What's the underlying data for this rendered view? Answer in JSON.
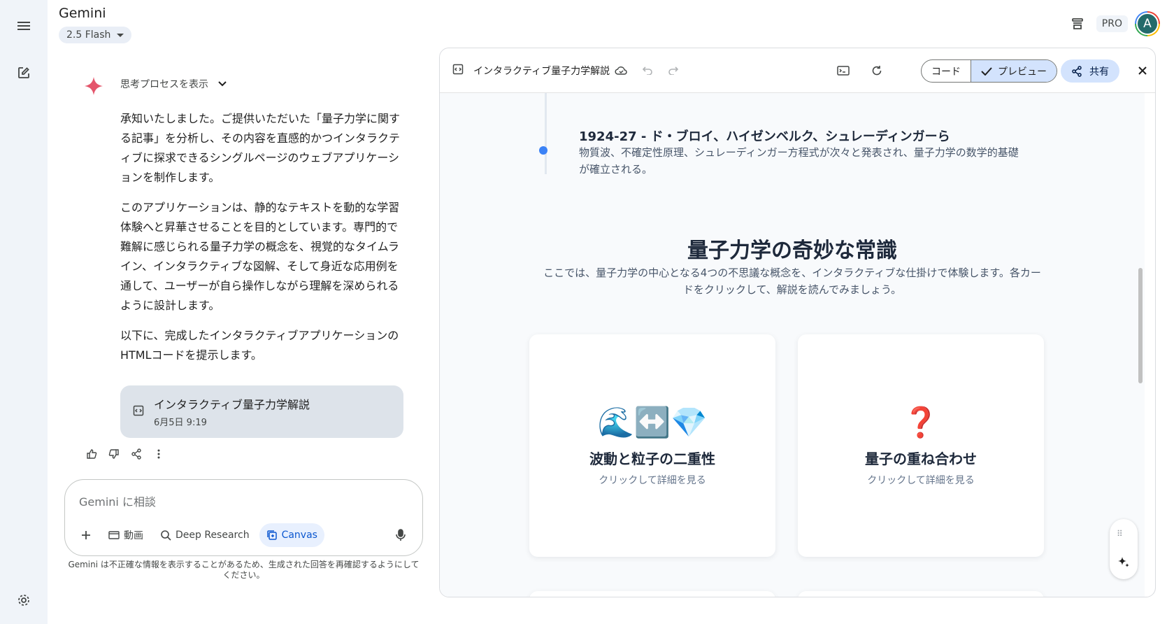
{
  "app": {
    "title": "Gemini",
    "model": "2.5 Flash",
    "pro_label": "PRO",
    "avatar_initial": "A"
  },
  "rail": {
    "menu_icon": "menu-icon",
    "new_chat_icon": "edit-icon",
    "settings_icon": "gear-icon"
  },
  "chat": {
    "thought_label": "思考プロセスを表示",
    "paragraphs": [
      "承知いたしました。ご提供いただいた「量子力学に関する記事」を分析し、その内容を直感的かつインタラクティブに探求できるシングルページのウェブアプリケーションを制作します。",
      "このアプリケーションは、静的なテキストを動的な学習体験へと昇華させることを目的としています。専門的で難解に感じられる量子力学の概念を、視覚的なタイムライン、インタラクティブな図解、そして身近な応用例を通して、ユーザーが自ら操作しながら理解を深められるように設計します。",
      "以下に、完成したインタラクティブアプリケーションのHTMLコードを提示します。"
    ],
    "artifact": {
      "title": "インタラクティブ量子力学解説",
      "date": "6月5日 9:19"
    }
  },
  "input": {
    "placeholder": "Gemini に相談",
    "tools": {
      "video": "動画",
      "deep_research": "Deep Research",
      "canvas": "Canvas"
    },
    "disclaimer": "Gemini は不正確な情報を表示することがあるため、生成された回答を再確認するようにしてください。"
  },
  "canvas": {
    "title": "インタラクティブ量子力学解説",
    "code_label": "コード",
    "preview_label": "プレビュー",
    "share_label": "共有",
    "timeline": {
      "title": "1924-27 - ド・ブロイ、ハイゼンベルク、シュレーディンガーら",
      "desc": "物質波、不確定性原理、シュレーディンガー方程式が次々と発表され、量子力学の数学的基礎が確立される。"
    },
    "section_title": "量子力学の奇妙な常識",
    "section_lead": "ここでは、量子力学の中心となる4つの不思議な概念を、インタラクティブな仕掛けで体験します。各カードをクリックして、解説を読んでみましょう。",
    "cards": [
      {
        "emoji": "🌊↔️💎",
        "title": "波動と粒子の二重性",
        "hint": "クリックして詳細を見る"
      },
      {
        "emoji": "❓",
        "title": "量子の重ね合わせ",
        "hint": "クリックして詳細を見る"
      }
    ]
  }
}
